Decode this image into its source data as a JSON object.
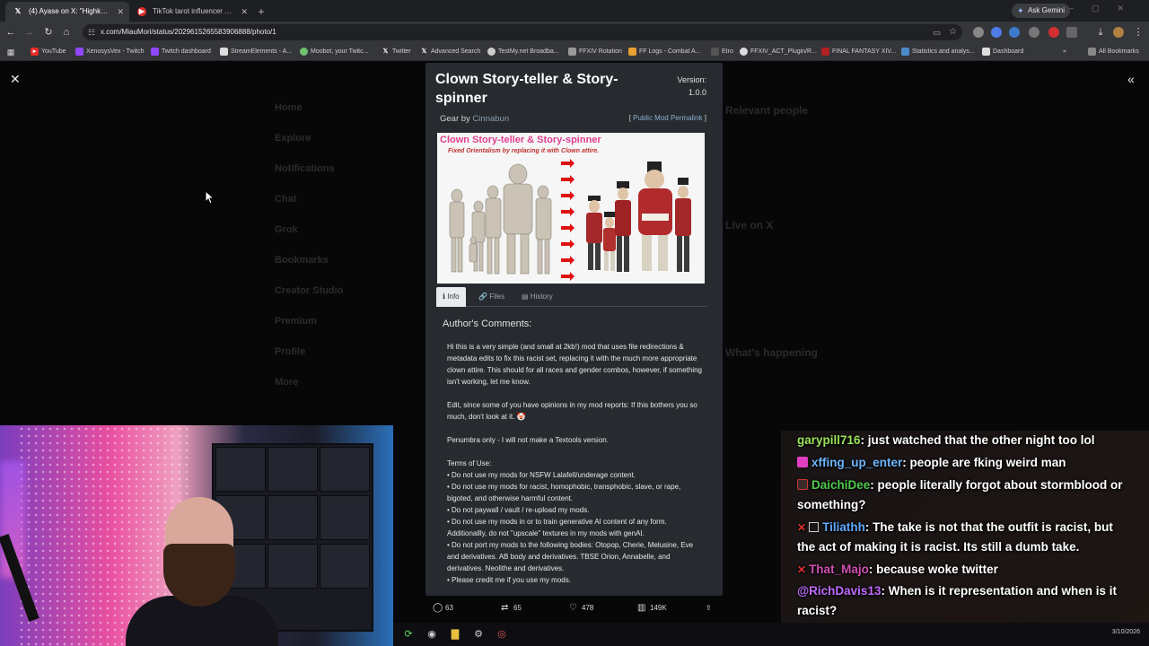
{
  "browser": {
    "tabs": [
      {
        "label": "(4) Ayase on X: \"Highkey, it get",
        "icon": "x-logo-icon",
        "active": true
      },
      {
        "label": "TikTok tarot influencer must pa",
        "icon": "youtube-icon",
        "active": false
      }
    ],
    "new_tab": "+",
    "gemini_label": "Ask Gemini",
    "url": "x.com/MiauMori/status/2029615265583906888/photo/1",
    "bookmarks": [
      "YouTube",
      "XenosysVex - Twitch",
      "Twitch dashboard",
      "StreamElements - A...",
      "Moobot, your Twitc...",
      "Twitter",
      "Advanced Search",
      "TestMy.net Broadba...",
      "FFXIV Rotation",
      "FF Logs - Combat A...",
      "Etro",
      "FFXIV_ACT_Plugin/R...",
      "FINAL FANTASY XIV...",
      "Statistics and analys...",
      "Dashboard"
    ],
    "all_bookmarks": "All Bookmarks"
  },
  "x_nav": [
    "Home",
    "Explore",
    "Notifications",
    "Chat",
    "Grok",
    "Bookmarks",
    "Creator Studio",
    "Premium",
    "Profile",
    "More"
  ],
  "x_right": {
    "relevant_people": "Relevant people",
    "live_on_x": "Live on X",
    "whats_happening": "What's happening"
  },
  "mod": {
    "title": "Clown Story-teller & Story-spinner",
    "version_label": "Version:",
    "version": "1.0.0",
    "gear_by": "Gear by",
    "author": "Cinnabun",
    "permalink": "Public Mod Permalink",
    "image_title": "Clown Story-teller & Story-spinner",
    "image_subtitle": "Fixed Orientalism by replacing it with Clown attire.",
    "tabs": [
      "Info",
      "Files",
      "History"
    ],
    "comments_heading": "Author's Comments:",
    "para1": "Hi this is a very simple (and small at 2kb!) mod that uses file redirections & metadata edits to fix this racist set, replacing it with the much more appropriate clown attire. This should for all races and gender combos, however, if something isn't working, let me know.",
    "para2": "Edit, since some of you have opinions in my mod reports: If this bothers you so much, don't look at it. 🤡",
    "para3": "Penumbra only - I will not make a Textools version.",
    "terms_heading": "Terms of Use:",
    "terms": [
      "• Do not use my mods for NSFW Lalafell/underage content.",
      "• Do not use my mods for racist, homophobic, transphobic, slave, or rape, bigoted, and otherwise harmful content.",
      "• Do not paywall / vault / re-upload my mods.",
      "• Do not use my mods in or to train generative AI content of any form. Additionallly, do not \"upscale\" textures in my mods with genAI.",
      "• Do not port my mods to the following bodies: Otopop, Cherie, Melusine, Eve and derivatives. AB body and derivatives. TBSE Orion, Annabelle, and derivatives. Neolithe and derivatives.",
      "• Please credit me if you use my mods."
    ]
  },
  "tweet_actions": {
    "replies": "63",
    "reposts": "65",
    "likes": "478",
    "views": "149K"
  },
  "chat": [
    {
      "user": "garypill716",
      "color": "#9be45a",
      "text": ": just watched that the other night too lol"
    },
    {
      "user": "xffing_up_enter",
      "color": "#6fb6ff",
      "text": ": people are fking weird man"
    },
    {
      "user": "DaichiDee",
      "color": "#4ec94e",
      "text": ": people literally forgot about stormblood or something?"
    },
    {
      "user": "Tiliathh",
      "color": "#5fa8ff",
      "text": ": The take is not that the outfit is racist, but the act of making it is racist. Its still a dumb take."
    },
    {
      "user": "That_Majo",
      "color": "#d14fb0",
      "text": ": because woke twitter"
    },
    {
      "user": "@RichDavis13",
      "color": "#c06bff",
      "text": ": When is it representation and when is it racist?"
    }
  ],
  "taskbar": {
    "date": "3/10/2026"
  }
}
